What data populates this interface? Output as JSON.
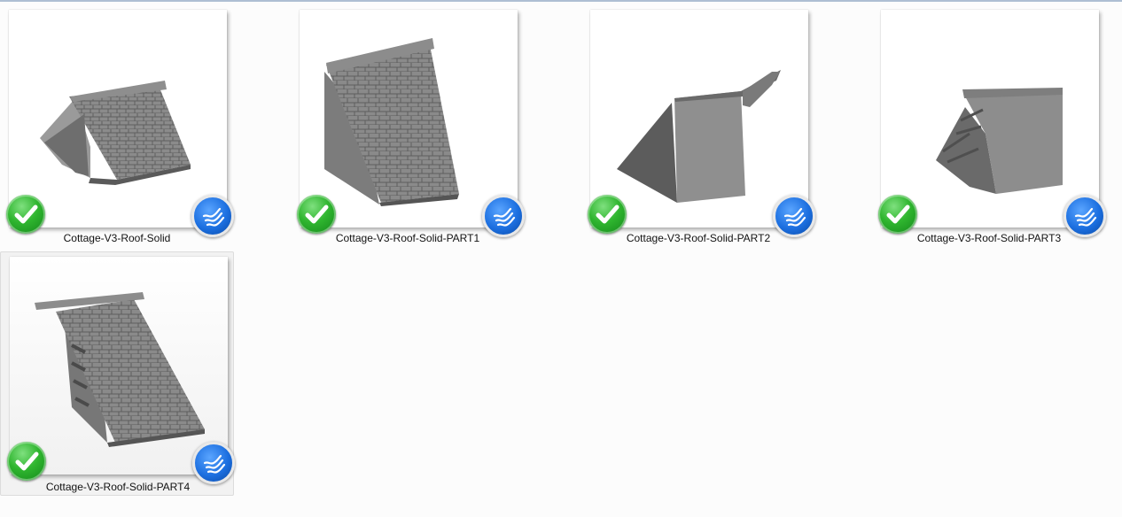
{
  "files": [
    {
      "name": "Cottage-V3-Roof-Solid",
      "status_icon": "green-check-icon",
      "app_icon": "brand-waves-icon"
    },
    {
      "name": "Cottage-V3-Roof-Solid-PART1",
      "status_icon": "green-check-icon",
      "app_icon": "brand-waves-icon"
    },
    {
      "name": "Cottage-V3-Roof-Solid-PART2",
      "status_icon": "green-check-icon",
      "app_icon": "brand-waves-icon"
    },
    {
      "name": "Cottage-V3-Roof-Solid-PART3",
      "status_icon": "green-check-icon",
      "app_icon": "brand-waves-icon"
    },
    {
      "name": "Cottage-V3-Roof-Solid-PART4",
      "status_icon": "green-check-icon",
      "app_icon": "brand-waves-icon",
      "selected": true
    }
  ],
  "colors": {
    "status_green": "#2fb52f",
    "brand_blue": "#1c6fe0",
    "selection_bg": "#f2f2f2",
    "model_gray": "#7a7a7a"
  }
}
